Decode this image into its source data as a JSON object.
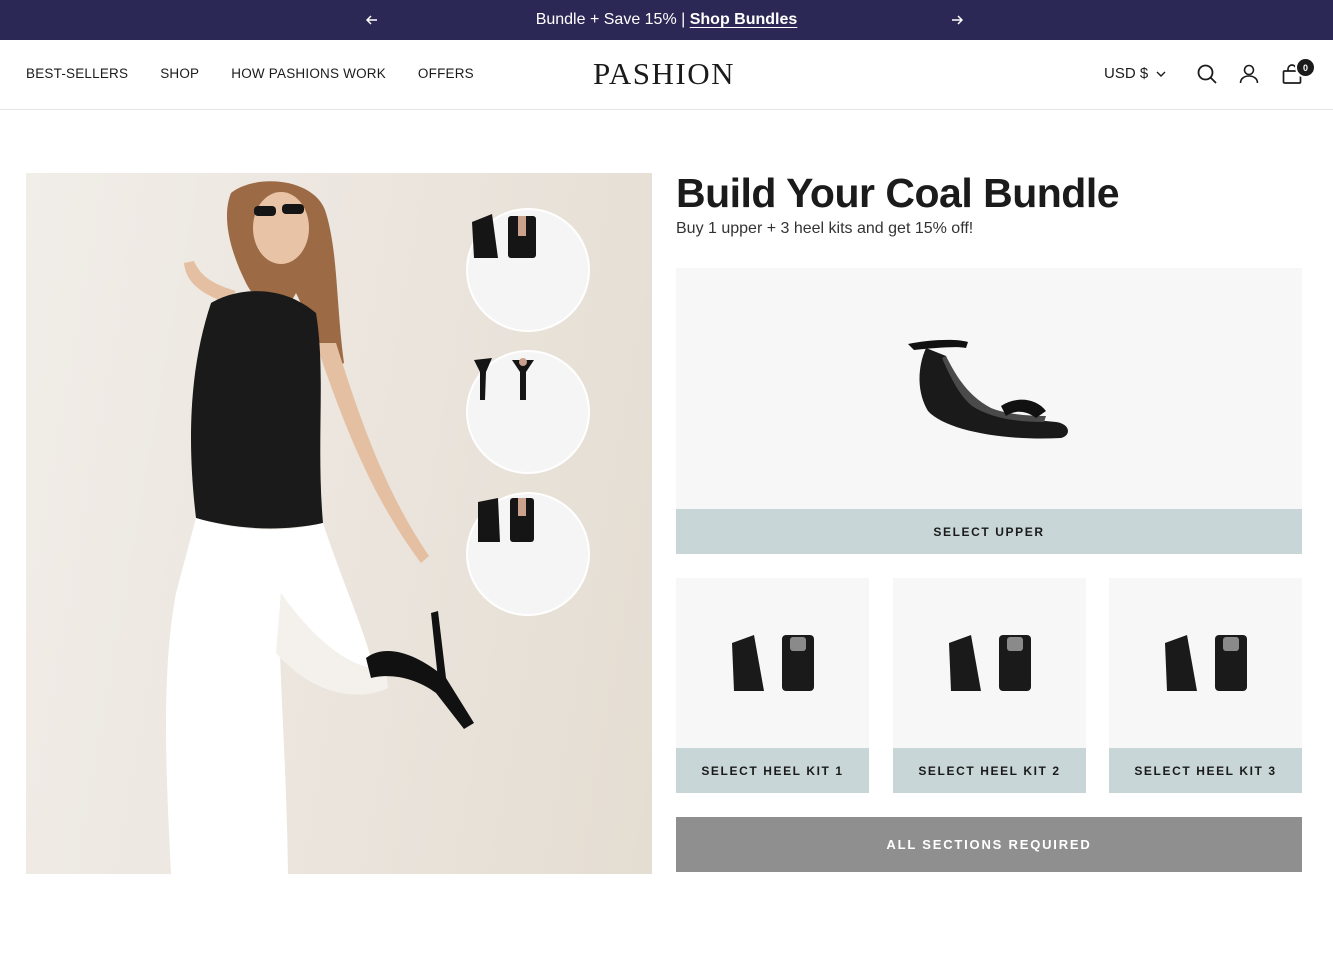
{
  "announcement": {
    "text": "Bundle + Save 15% | ",
    "link_label": "Shop Bundles"
  },
  "header": {
    "nav": [
      "BEST-SELLERS",
      "SHOP",
      "HOW PASHIONS WORK",
      "OFFERS"
    ],
    "logo": "PASHION",
    "currency": "USD $",
    "cart_count": "0",
    "icons": [
      "search-icon",
      "account-icon",
      "cart-icon"
    ]
  },
  "bundle": {
    "title": "Build Your Coal Bundle",
    "subtitle": "Buy 1 upper + 3 heel kits and get 15% off!",
    "select_upper": "SELECT UPPER",
    "heel_kits": [
      "SELECT HEEL KIT 1",
      "SELECT HEEL KIT 2",
      "SELECT HEEL KIT 3"
    ],
    "submit": "ALL SECTIONS REQUIRED"
  },
  "colors": {
    "announcement_bg": "#2b2855",
    "select_bg": "#c8d6d8",
    "disabled_bg": "#8f8f8f"
  }
}
